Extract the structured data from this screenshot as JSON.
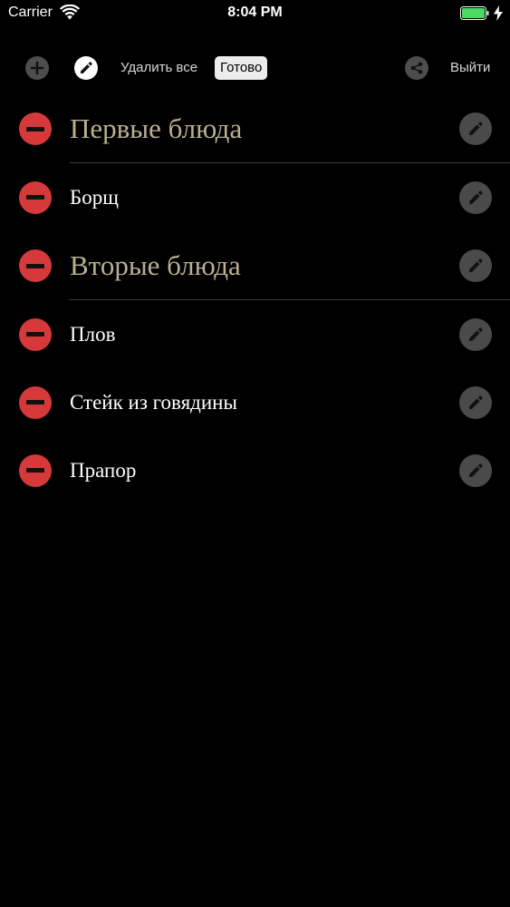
{
  "status_bar": {
    "carrier": "Carrier",
    "time": "8:04 PM",
    "battery_color": "#4cd964"
  },
  "toolbar": {
    "add_icon": "plus-circle-icon",
    "edit_icon": "pencil-icon",
    "delete_all_label": "Удалить все",
    "done_label": "Готово",
    "share_icon": "share-icon",
    "logout_label": "Выйти"
  },
  "list": {
    "rows": [
      {
        "type": "category",
        "label": "Первые блюда"
      },
      {
        "type": "item",
        "label": "Борщ"
      },
      {
        "type": "category",
        "label": "Вторые блюда"
      },
      {
        "type": "item",
        "label": "Плов"
      },
      {
        "type": "item",
        "label": "Стейк из говядины"
      },
      {
        "type": "item",
        "label": "Прапор"
      }
    ]
  },
  "colors": {
    "background": "#000000",
    "delete_red": "#d5393a",
    "category_text": "#b9b092",
    "item_text": "#ffffff",
    "icon_gray": "#4a4a4a"
  }
}
